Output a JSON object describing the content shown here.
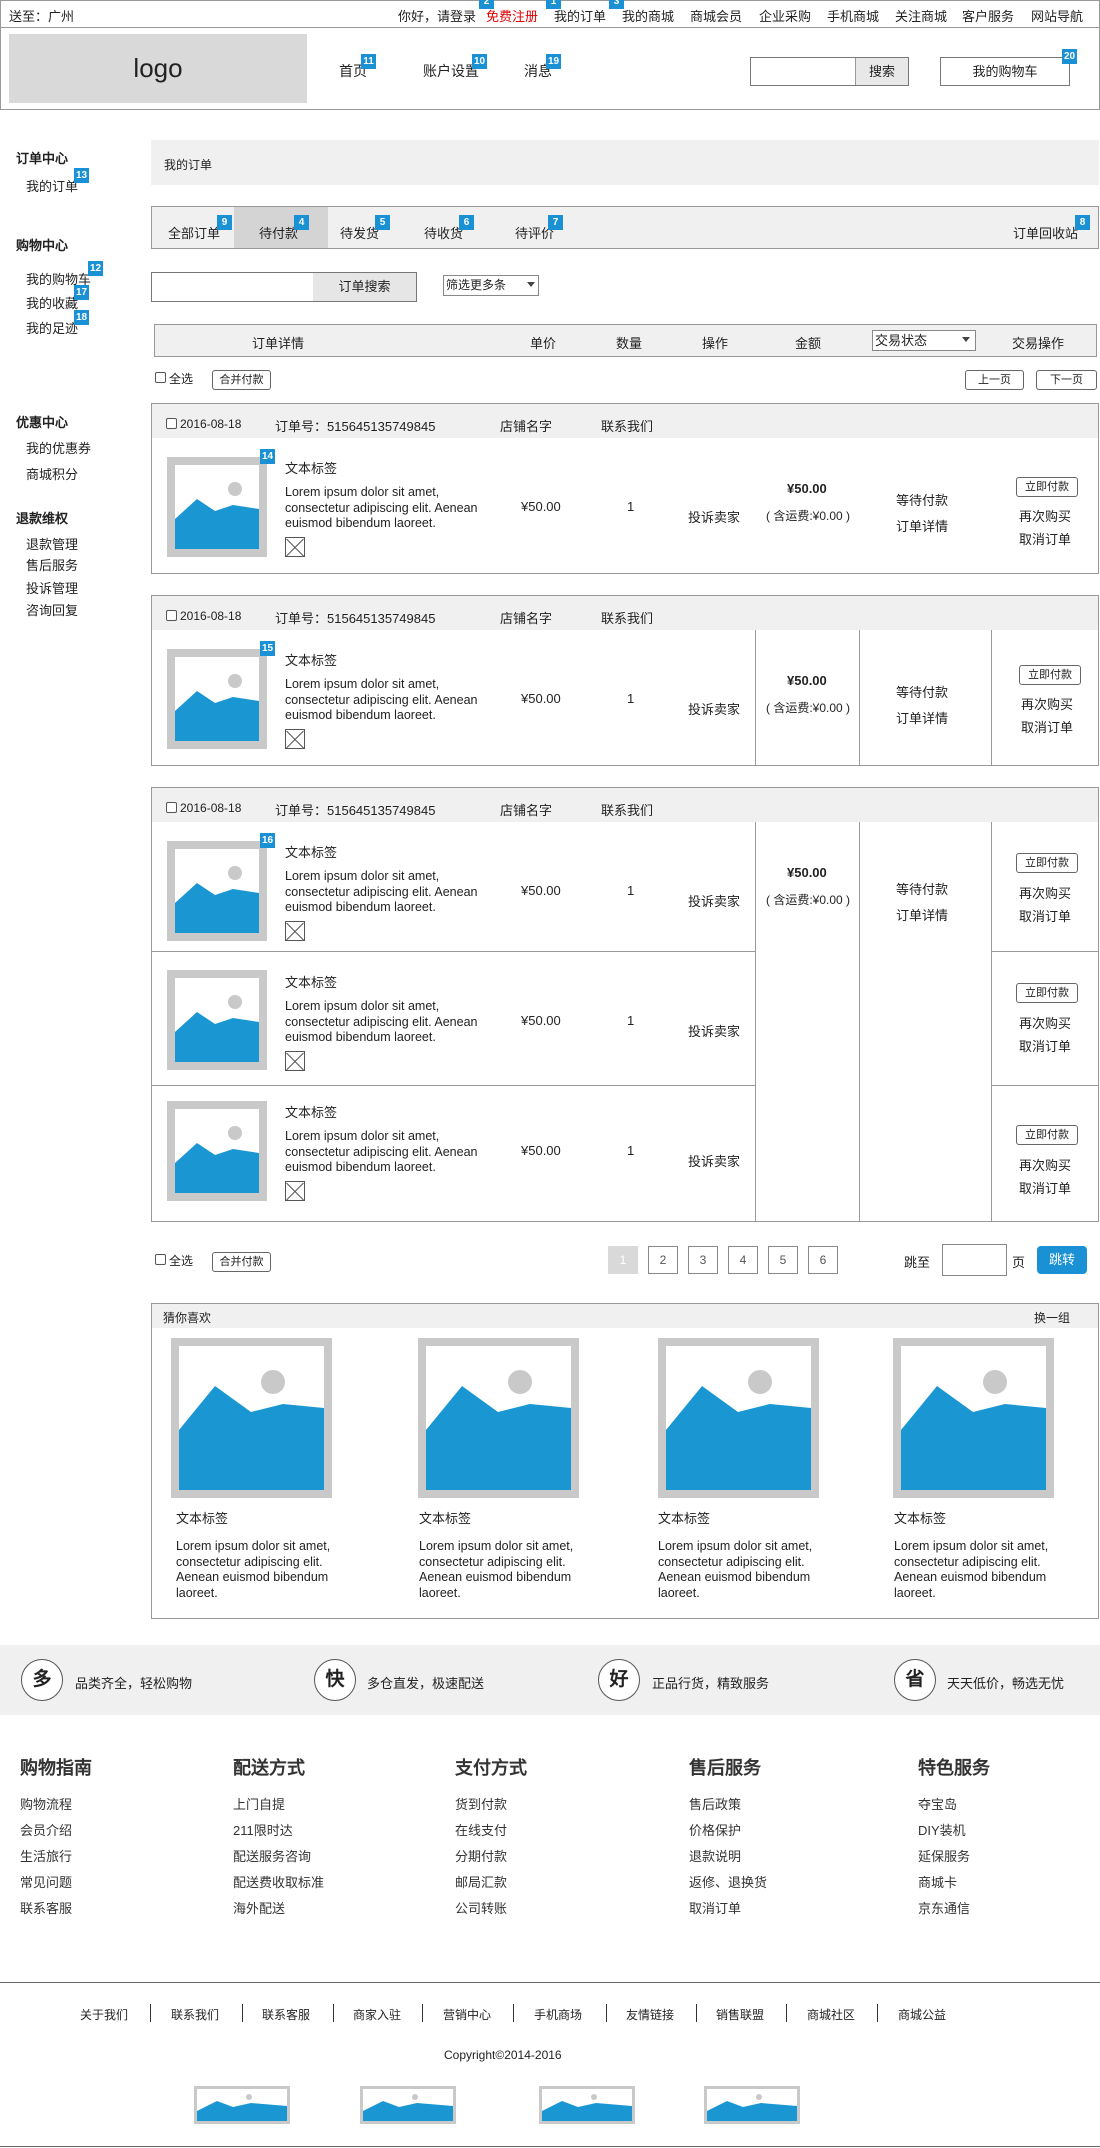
{
  "topbar": {
    "location": "送至：广州",
    "greeting": "你好，请登录",
    "register": "免费注册",
    "links": [
      "我的订单",
      "我的商城",
      "商城会员",
      "企业采购",
      "手机商城",
      "关注商城",
      "客户服务",
      "网站导航"
    ]
  },
  "header": {
    "logo": "logo",
    "nav": [
      "首页",
      "账户设置",
      "消息"
    ],
    "search_button": "搜索",
    "cart": "我的购物车"
  },
  "badges": [
    "1",
    "2",
    "3",
    "4",
    "5",
    "6",
    "7",
    "8",
    "9",
    "10",
    "11",
    "12",
    "13",
    "14",
    "15",
    "16",
    "17",
    "18",
    "19",
    "20"
  ],
  "sidebar": {
    "sections": [
      {
        "title": "订单中心",
        "items": [
          "我的订单"
        ]
      },
      {
        "title": "购物中心",
        "items": [
          "我的购物车",
          "我的收藏",
          "我的足迹"
        ]
      },
      {
        "title": "优惠中心",
        "items": [
          "我的优惠券",
          "商城积分"
        ]
      },
      {
        "title": "退款维权",
        "items": [
          "退款管理",
          "售后服务",
          "投诉管理",
          "咨询回复"
        ]
      }
    ]
  },
  "main": {
    "breadcrumb": "我的订单",
    "tabs": [
      "全部订单",
      "待付款",
      "待发货",
      "待收货",
      "待评价"
    ],
    "recycle": "订单回收站",
    "search_button": "订单搜索",
    "filter": "筛选更多条",
    "columns": [
      "订单详情",
      "单价",
      "数量",
      "操作",
      "金额",
      "交易状态",
      "交易操作"
    ],
    "select_all": "全选",
    "merge_pay": "合并付款",
    "prev": "上一页",
    "next": "下一页",
    "order": {
      "date": "2016-08-18",
      "number": "订单号：515645135749845",
      "shop": "店铺名字",
      "contact": "联系我们"
    },
    "item": {
      "label": "文本标签",
      "desc": "Lorem ipsum dolor sit amet, consectetur adipiscing elit. Aenean euismod bibendum laoreet.",
      "price": "¥50.00",
      "qty": "1",
      "complain": "投诉卖家",
      "pay": "立即付款",
      "rebuy": "再次购买",
      "cancel": "取消订单"
    },
    "summary": {
      "total": "¥50.00",
      "shipping": "( 含运费:¥0.00 )",
      "status": "等待付款",
      "detail": "订单详情"
    },
    "pagination": {
      "pages": [
        "1",
        "2",
        "3",
        "4",
        "5",
        "6"
      ],
      "goto": "跳至",
      "page": "页",
      "jump": "跳转"
    }
  },
  "recommend": {
    "title": "猜你喜欢",
    "refresh": "换一组",
    "label": "文本标签",
    "desc": "Lorem ipsum dolor sit amet, consectetur adipiscing elit. Aenean euismod bibendum laoreet."
  },
  "features": [
    {
      "icon": "多",
      "text": "品类齐全，轻松购物"
    },
    {
      "icon": "快",
      "text": "多仓直发，极速配送"
    },
    {
      "icon": "好",
      "text": "正品行货，精致服务"
    },
    {
      "icon": "省",
      "text": "天天低价，畅选无忧"
    }
  ],
  "footer": {
    "columns": [
      {
        "title": "购物指南",
        "items": [
          "购物流程",
          "会员介绍",
          "生活旅行",
          "常见问题",
          "联系客服"
        ]
      },
      {
        "title": "配送方式",
        "items": [
          "上门自提",
          "211限时达",
          "配送服务咨询",
          "配送费收取标准",
          "海外配送"
        ]
      },
      {
        "title": "支付方式",
        "items": [
          "货到付款",
          "在线支付",
          "分期付款",
          "邮局汇款",
          "公司转账"
        ]
      },
      {
        "title": "售后服务",
        "items": [
          "售后政策",
          "价格保护",
          "退款说明",
          "返修、退换货",
          "取消订单"
        ]
      },
      {
        "title": "特色服务",
        "items": [
          "夺宝岛",
          "DIY装机",
          "延保服务",
          "商城卡",
          "京东通信"
        ]
      }
    ],
    "links": [
      "关于我们",
      "联系我们",
      "联系客服",
      "商家入驻",
      "营销中心",
      "手机商场",
      "友情链接",
      "销售联盟",
      "商城社区",
      "商城公益"
    ],
    "copyright": "Copyright©2014-2016"
  },
  "colors": {
    "accent": "#1a90d5",
    "register": "#e00000",
    "image_blue": "#1a96d3"
  }
}
